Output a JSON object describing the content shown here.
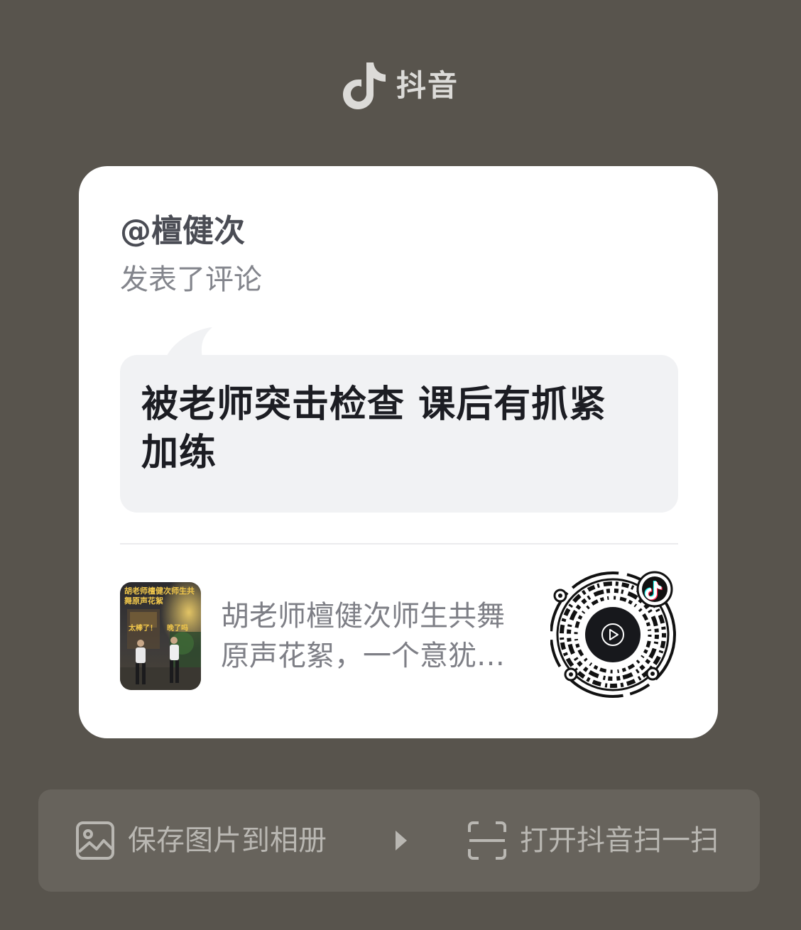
{
  "app": {
    "name": "抖音",
    "logo_icon": "tiktok-note-icon"
  },
  "card": {
    "author": "@檀健次",
    "action": "发表了评论",
    "comment_line1": "被老师突击检查 课后有抓紧",
    "comment_line2": "加练",
    "video": {
      "title_line1": "胡老师檀健次师生共舞",
      "title_line2": "原声花絮，一个意犹…",
      "thumbnail_caption": "胡老师檀健次师生共舞原声花絮",
      "thumbnail_tag_left": "太棒了！",
      "thumbnail_tag_right": "晚了吗"
    },
    "qr_icon": "qr-code-icon",
    "play_icon": "play-icon"
  },
  "actions": {
    "save_label": "保存图片到相册",
    "save_icon": "image-icon",
    "arrow_icon": "triangle-right-icon",
    "scan_label": "打开抖音扫一扫",
    "scan_icon": "scan-icon"
  },
  "colors": {
    "background": "#58544d",
    "card": "#ffffff",
    "bubble": "#f1f2f4",
    "bar": "#67635c",
    "tiktok_cyan": "#25f4ee",
    "tiktok_red": "#fe2c55"
  }
}
